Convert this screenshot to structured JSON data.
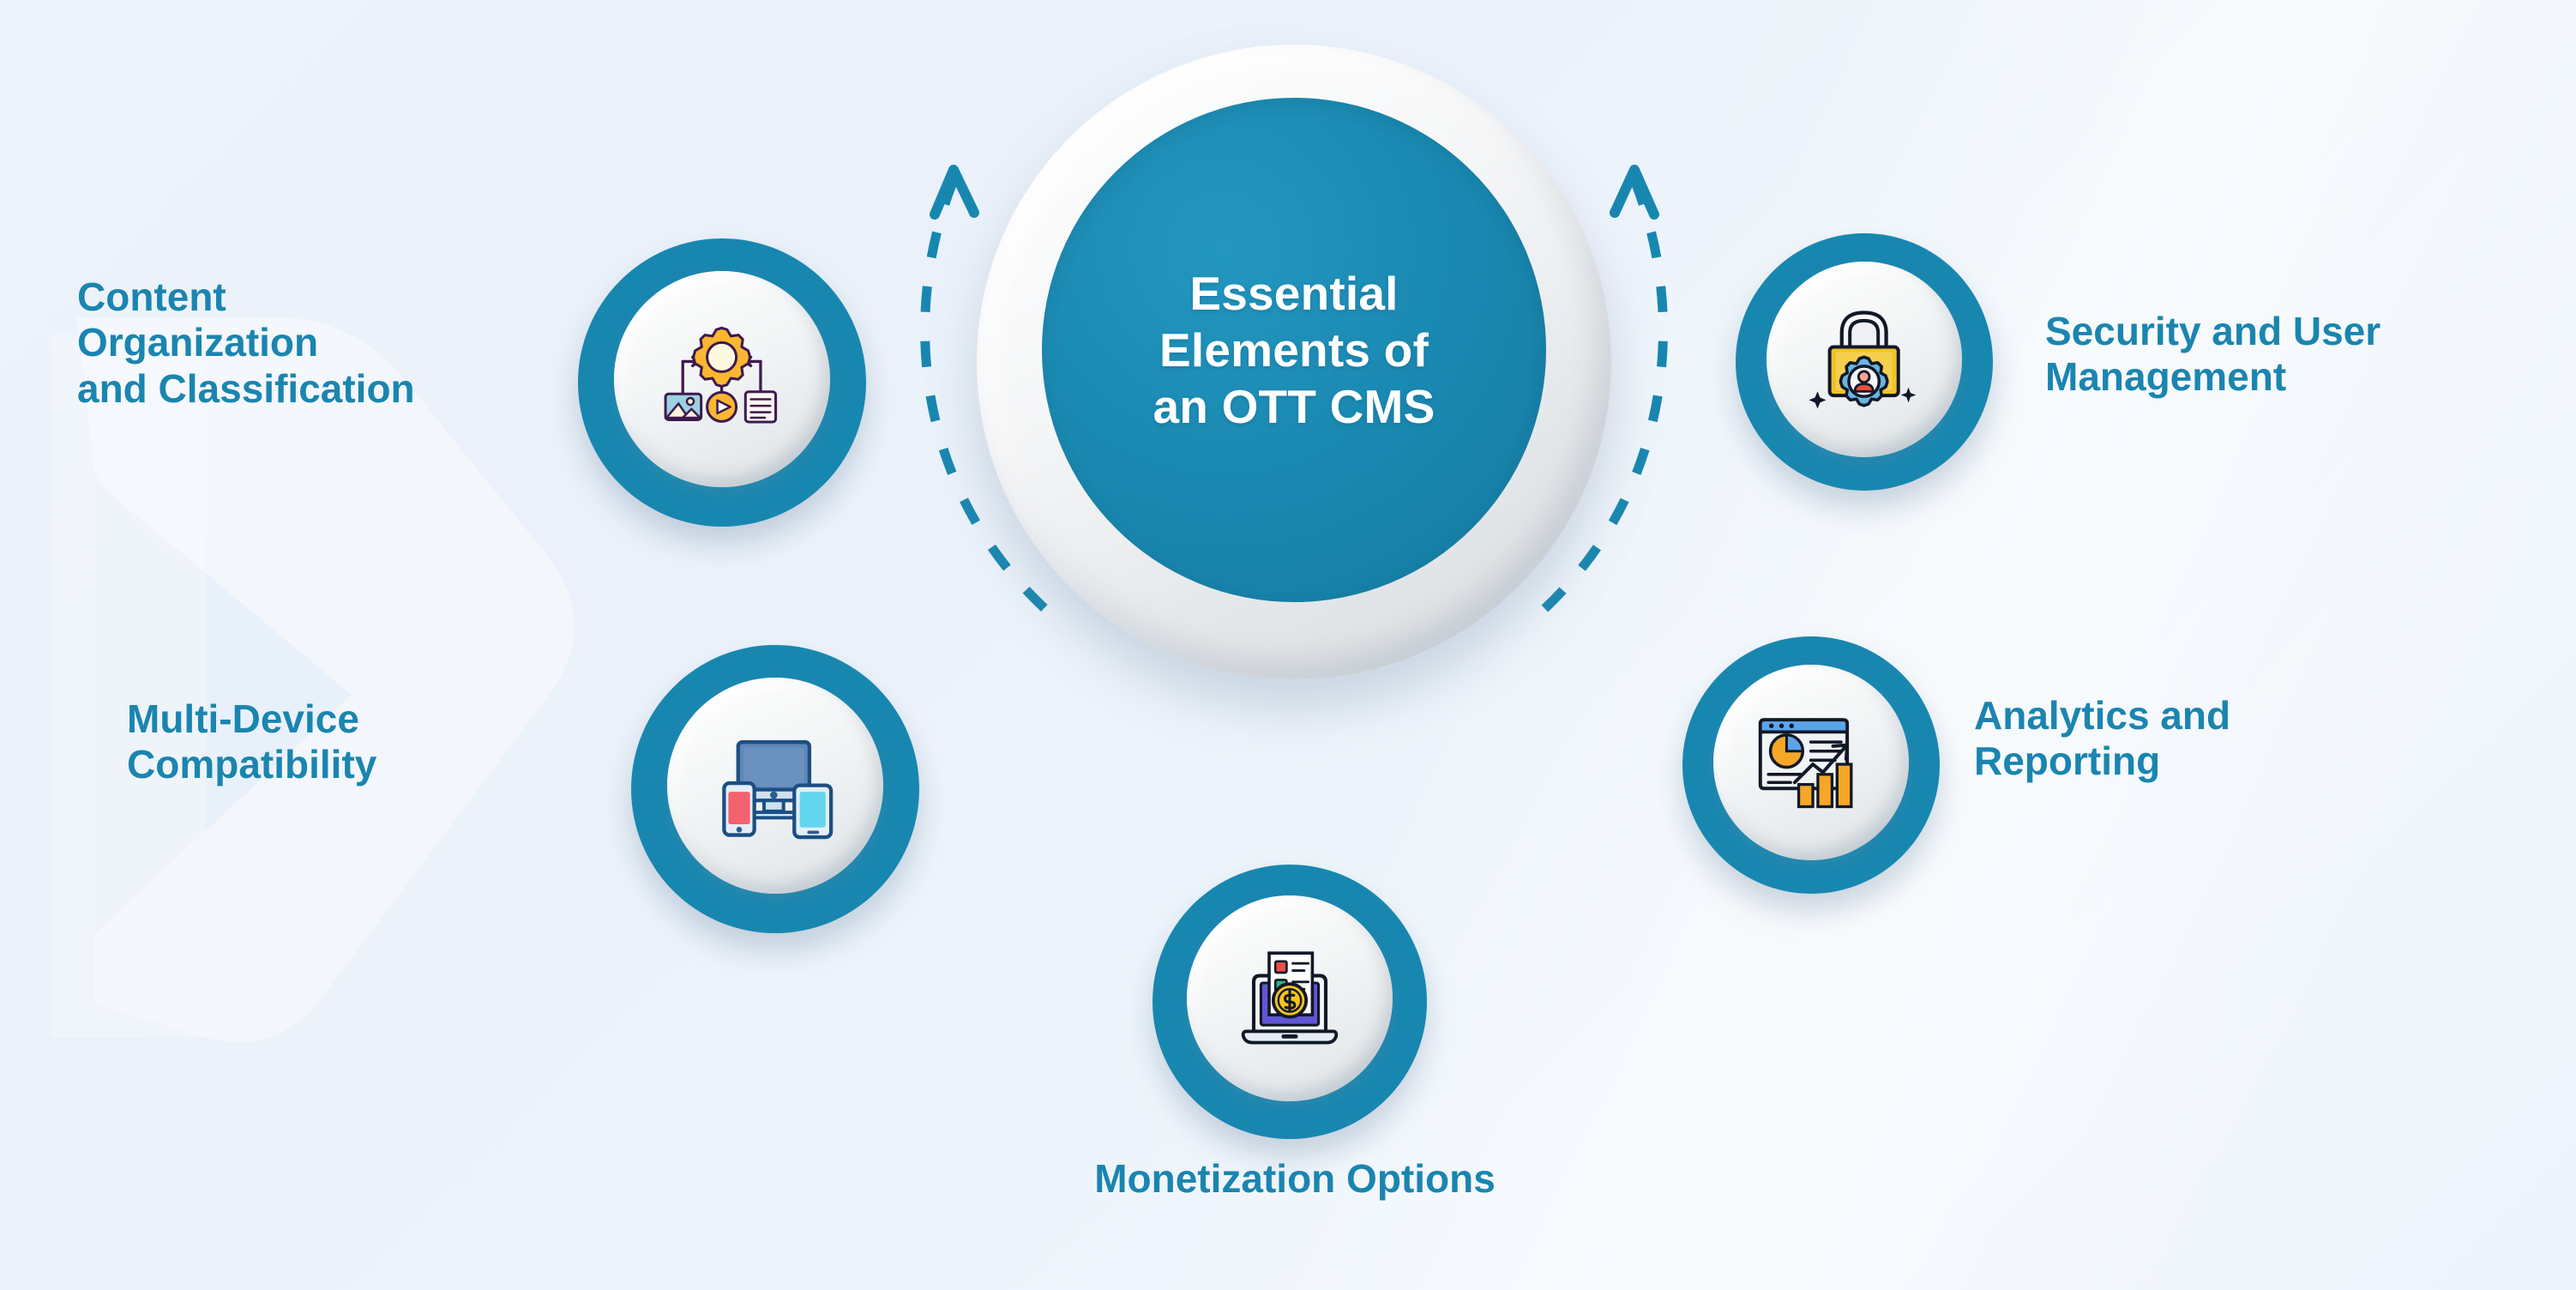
{
  "theme": {
    "accent_teal": "#1887b0",
    "label_blue": "#1a85b0",
    "hub_text": "#ffffff",
    "background": "#eef3fb"
  },
  "hub": {
    "title_line1": "Essential",
    "title_line2": "Elements of",
    "title_line3": "an OTT CMS",
    "title_full": "Essential Elements of an OTT CMS"
  },
  "nodes": [
    {
      "id": "content-organization",
      "label_line1": "Content",
      "label_line2": "Organization",
      "label_line3": "and Classification",
      "icon": "content-workflow-gear-icon",
      "position": "top-left"
    },
    {
      "id": "multi-device",
      "label_line1": "Multi-Device",
      "label_line2": "Compatibility",
      "icon": "multi-device-icon",
      "position": "mid-left"
    },
    {
      "id": "monetization",
      "label_line1": "Monetization Options",
      "icon": "laptop-dollar-icon",
      "position": "bottom-center"
    },
    {
      "id": "security-user-management",
      "label_line1": "Security and User",
      "label_line2": "Management",
      "icon": "padlock-user-gear-icon",
      "position": "top-right"
    },
    {
      "id": "analytics-reporting",
      "label_line1": "Analytics and",
      "label_line2": "Reporting",
      "icon": "analytics-dashboard-icon",
      "position": "mid-right"
    }
  ],
  "decor": {
    "arc_left": "dashed-arc-arrow-left",
    "arc_right": "dashed-arc-arrow-right",
    "watermark": "play-chevron-watermark"
  }
}
